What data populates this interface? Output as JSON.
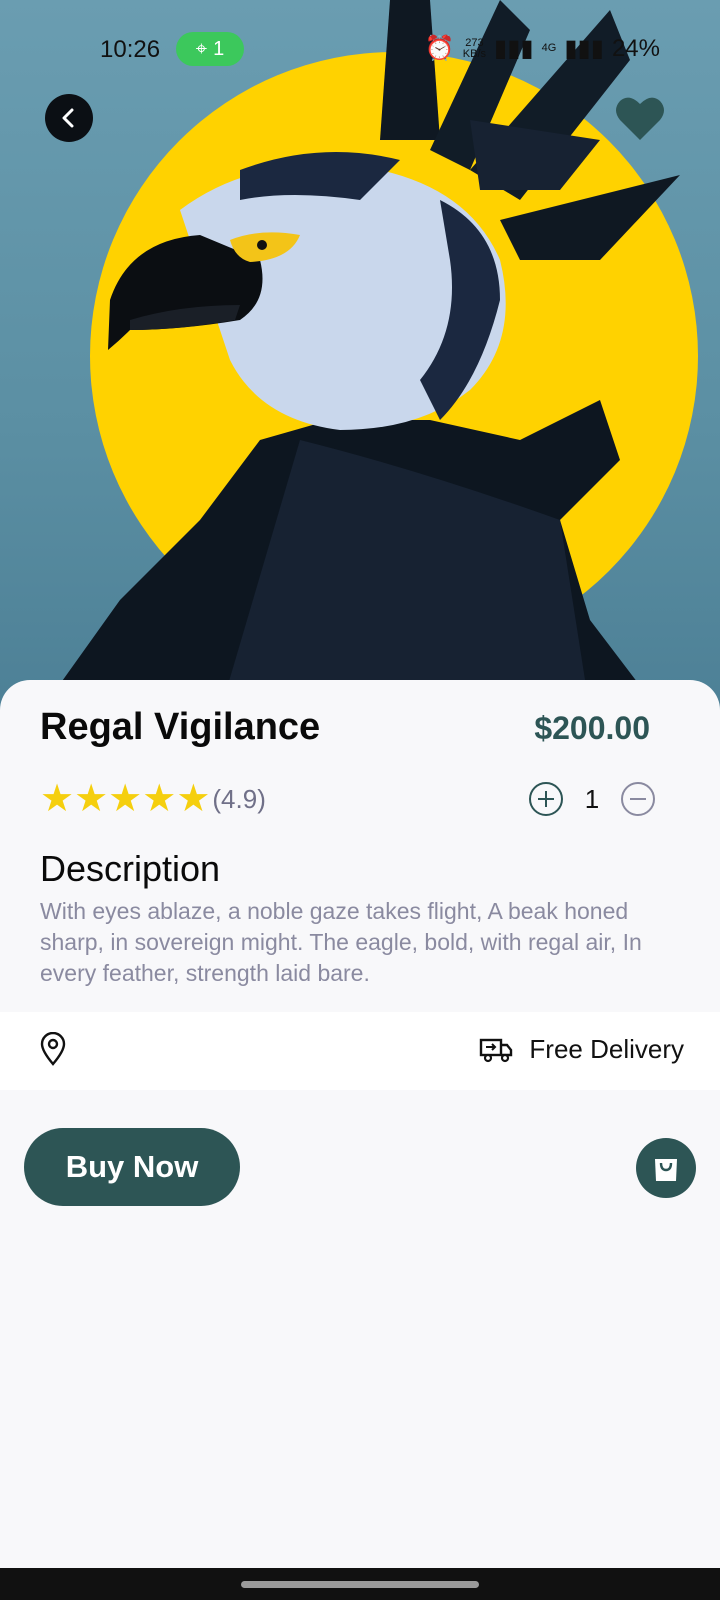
{
  "status_bar": {
    "time": "10:26",
    "hotspot_count": "1",
    "net_speed_value": "273",
    "net_speed_unit": "KB/s",
    "network_type": "4G",
    "battery": "24%"
  },
  "product": {
    "title": "Regal Vigilance",
    "price": "$200.00",
    "rating_stars": 5,
    "rating_text": "(4.9)",
    "quantity": "1",
    "description_heading": "Description",
    "description": "With eyes ablaze, a noble gaze takes flight, A beak honed sharp, in sovereign might. The eagle, bold, with regal air, In every feather, strength laid bare."
  },
  "delivery": {
    "label": "Free Delivery"
  },
  "actions": {
    "buy_now_label": "Buy Now"
  },
  "icons": {
    "back": "chevron-left-icon",
    "favorite": "heart-icon",
    "add": "plus-circle-icon",
    "remove": "minus-circle-icon",
    "location": "map-pin-icon",
    "delivery": "truck-icon",
    "cart": "shopping-bag-icon"
  },
  "colors": {
    "accent": "#2d5555",
    "star": "#f5cf0e",
    "hero_bg": "#5b8fa3",
    "sun": "#ffd200",
    "muted_text": "#8a8aa0"
  }
}
